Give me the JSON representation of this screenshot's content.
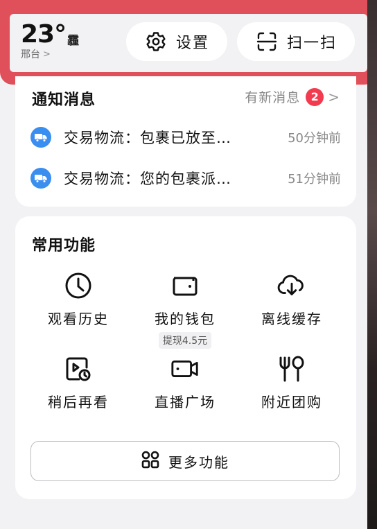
{
  "header": {
    "temperature": "23°",
    "weather": "霾",
    "city": "邢台",
    "city_chevron": ">",
    "settings_label": "设置",
    "scan_label": "扫一扫",
    "highlight_color": "#e0505a"
  },
  "notifications": {
    "title": "通知消息",
    "new_label": "有新消息",
    "badge_count": "2",
    "chevron": ">",
    "items": [
      {
        "icon": "truck-icon",
        "text": "交易物流：包裹已放至…",
        "time": "50分钟前"
      },
      {
        "icon": "truck-icon",
        "text": "交易物流：您的包裹派…",
        "time": "51分钟前"
      }
    ]
  },
  "functions": {
    "title": "常用功能",
    "items": [
      {
        "icon": "clock-icon",
        "label": "观看历史"
      },
      {
        "icon": "wallet-icon",
        "label": "我的钱包",
        "sub": "提现4.5元"
      },
      {
        "icon": "cloud-download-icon",
        "label": "离线缓存"
      },
      {
        "icon": "watch-later-icon",
        "label": "稍后再看"
      },
      {
        "icon": "camera-icon",
        "label": "直播广场"
      },
      {
        "icon": "fork-spoon-icon",
        "label": "附近团购"
      }
    ],
    "more_label": "更多功能"
  },
  "colors": {
    "badge": "#f23b4f",
    "truck_icon_bg": "#3a8ef0"
  }
}
